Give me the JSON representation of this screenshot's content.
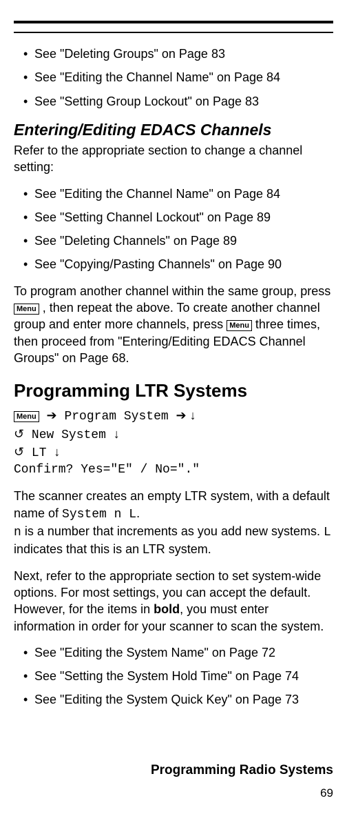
{
  "menuLabel": "Menu",
  "topBullets": [
    "See \"Deleting Groups\" on Page 83",
    "See \"Editing the Channel Name\" on Page 84",
    "See \"Setting Group Lockout\" on Page 83"
  ],
  "section1": {
    "heading": "Entering/Editing EDACS Channels",
    "intro": "Refer to the appropriate section to change a channel setting:",
    "bullets": [
      "See \"Editing the Channel Name\" on Page 84",
      "See \"Setting Channel Lockout\" on Page 89",
      "See \"Deleting Channels\" on Page 89",
      "See \"Copying/Pasting Channels\" on Page 90"
    ],
    "followPara": {
      "p1a": "To program another channel within the same group, press ",
      "p1b": " , then repeat the above. To create another channel group and enter more channels, press ",
      "p1c": " three times, then proceed from \"Entering/Editing EDACS Channel Groups\" on Page 68."
    }
  },
  "section2": {
    "heading": "Programming LTR Systems",
    "nav": {
      "l1a": " Program System ",
      "l2a": " New System ",
      "l3a": " LT ",
      "l4": "Confirm? Yes=\"E\" / No=\".\""
    },
    "paraA": {
      "a": "The scanner creates an empty LTR system, with a default name of ",
      "code1": "System n       L",
      "b": ".",
      "br": "",
      "code2": "n",
      "c": " is a number that increments as you add new systems. ",
      "code3": "L",
      "d": " indicates that this is an LTR system."
    },
    "paraB": {
      "a": "Next, refer to the appropriate section to set system-wide options. For most settings, you can accept the default. However, for the items in ",
      "bold": "bold",
      "b": ", you must enter information in order for your scanner to scan the system."
    },
    "bullets": [
      "See \"Editing the System Name\" on Page 72",
      "See \"Setting the System Hold Time\" on Page 74",
      "See \"Editing the System Quick Key\" on Page 73"
    ]
  },
  "footerTitle": "Programming Radio Systems",
  "pageNumber": "69"
}
